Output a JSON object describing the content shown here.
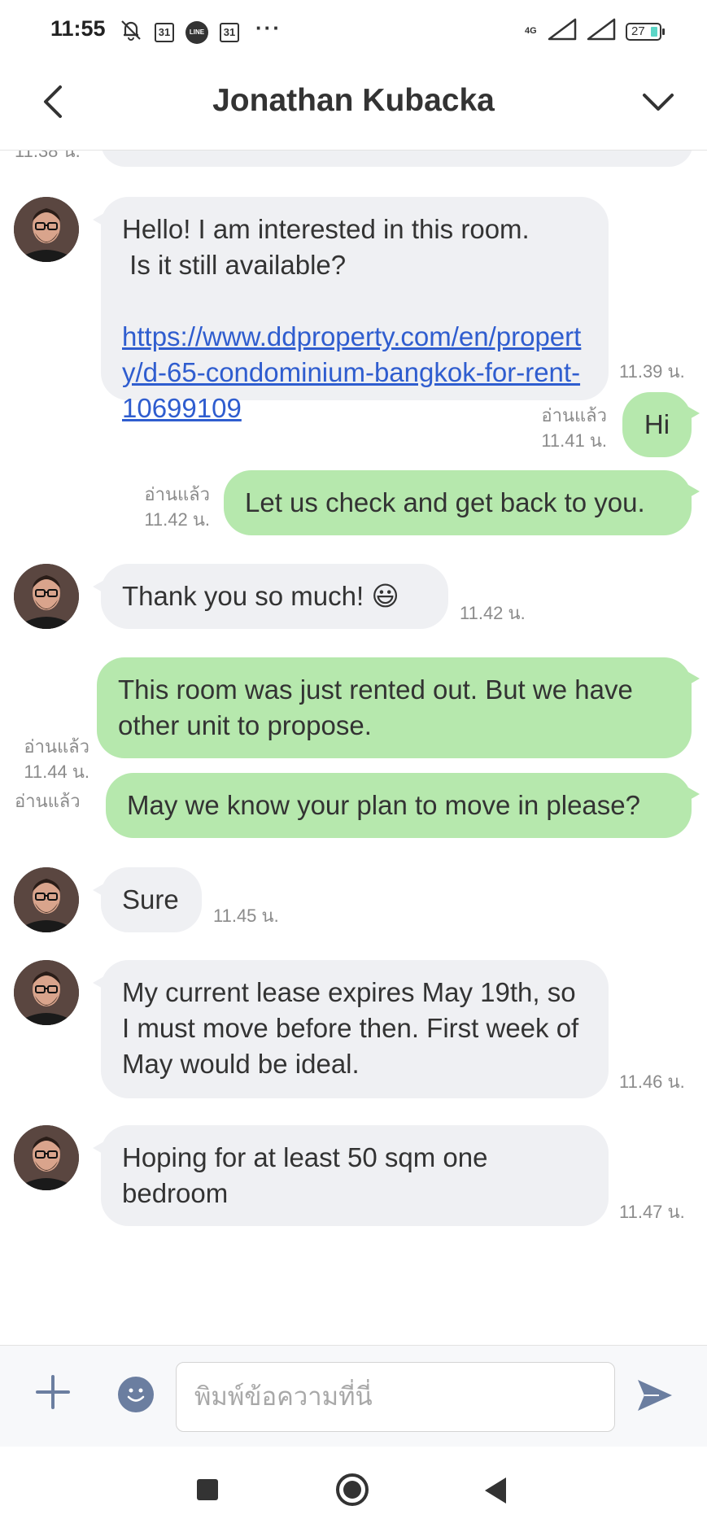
{
  "status_bar": {
    "time": "11:55",
    "calendar_day_1": "31",
    "line_label": "LINE",
    "calendar_day_2": "31",
    "more": "···",
    "network": "4G",
    "battery": "27"
  },
  "header": {
    "title": "Jonathan Kubacka"
  },
  "chat": {
    "top_partial_time": "11.38 น.",
    "messages": [
      {
        "direction": "in",
        "line1": "Hello! I am interested in this room.",
        "line2": " Is it still available?",
        "link": "https://www.ddproperty.com/en/property/d-65-condominium-bangkok-for-rent-10699109",
        "time": "11.39 น."
      },
      {
        "direction": "out",
        "text": "Hi",
        "read": "อ่านแล้ว",
        "time": "11.41 น."
      },
      {
        "direction": "out",
        "text": "Let us check and get back to you.",
        "read": "อ่านแล้ว",
        "time": "11.42 น."
      },
      {
        "direction": "in",
        "text": "Thank you so much! 😃",
        "time": "11.42 น."
      },
      {
        "direction": "out",
        "text": "This room was just rented out. But we have other unit to propose.",
        "read": "อ่านแล้ว"
      },
      {
        "direction": "out",
        "text": "May we know your plan to move in please?",
        "read": "อ่านแล้ว",
        "time": "11.44 น."
      },
      {
        "direction": "in",
        "text": "Sure",
        "time": "11.45 น."
      },
      {
        "direction": "in",
        "text": "My current lease expires May 19th, so I must move before then.  First week of May would be ideal.",
        "time": "11.46 น."
      },
      {
        "direction": "in",
        "text": "Hoping for at least 50 sqm one bedroom",
        "time": "11.47 น."
      }
    ]
  },
  "input_bar": {
    "placeholder": "พิมพ์ข้อความที่นี่"
  },
  "colors": {
    "incoming_bubble": "#eff0f3",
    "outgoing_bubble": "#b6e8ad",
    "link": "#2f5dcf",
    "send_icon": "#6b7ea0"
  }
}
